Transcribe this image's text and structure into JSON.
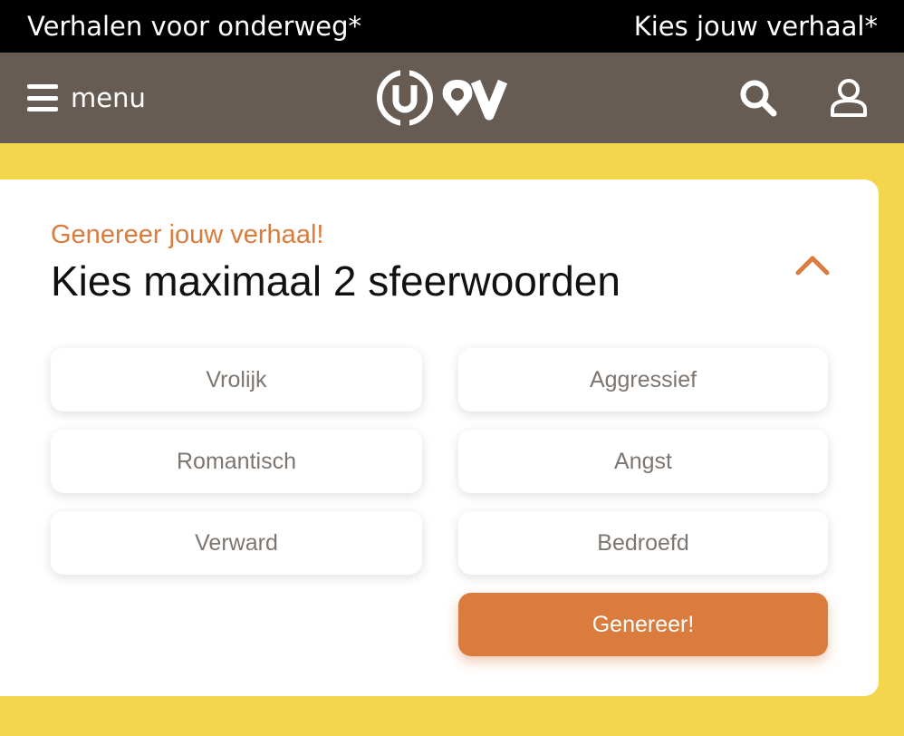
{
  "topbar": {
    "left_text": "Verhalen voor onderweg*",
    "right_text": "Kies jouw verhaal*"
  },
  "header": {
    "menu_label": "menu",
    "logo_text": "U OV",
    "icons": [
      "hamburger-icon",
      "search-icon",
      "user-icon"
    ],
    "background": "#675c53"
  },
  "card": {
    "subtitle": "Genereer jouw verhaal!",
    "title": "Kies maximaal 2 sfeerwoorden",
    "collapse_icon": "chevron-up-icon",
    "moods": [
      "Vrolijk",
      "Aggressief",
      "Romantisch",
      "Angst",
      "Verward",
      "Bedroefd"
    ],
    "generate_label": "Genereer!"
  },
  "colors": {
    "accent": "#d97c3e",
    "page_background": "#f4d64c",
    "topbar": "#000000",
    "chip_text": "#7d7670"
  }
}
